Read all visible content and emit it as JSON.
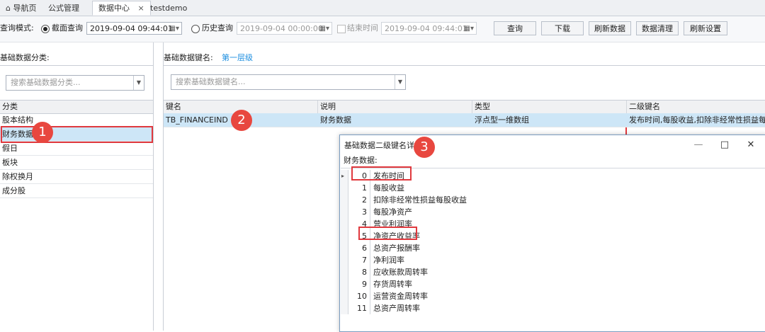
{
  "tabs": [
    {
      "label": "导航页"
    },
    {
      "label": "公式管理"
    },
    {
      "label": "数据中心",
      "close": "×"
    },
    {
      "label": "testdemo"
    }
  ],
  "toolbar": {
    "query_mode_label": "查询模式:",
    "snapshot_label": "截面查询",
    "snapshot_value": "2019-09-04 09:44:01",
    "history_label": "历史查询",
    "history_start": "2019-09-04 00:00:00",
    "end_time_label": "结束时间",
    "history_end": "2019-09-04 09:44:01",
    "buttons": [
      "查询",
      "下载",
      "刷新数据",
      "数据清理",
      "刷新设置"
    ]
  },
  "left": {
    "section_label": "基础数据分类:",
    "search_placeholder": "搜索基础数据分类...",
    "column_header": "分类",
    "items": [
      "股本结构",
      "财务数据",
      "假日",
      "板块",
      "除权换月",
      "成分股"
    ]
  },
  "right": {
    "section_label": "基础数据键名:",
    "level_label": "第一层级",
    "search_placeholder": "搜索基础数据键名...",
    "headers": [
      "键名",
      "说明",
      "类型",
      "二级键名"
    ],
    "row": {
      "key": "TB_FINANCEIND",
      "desc": "财务数据",
      "type": "浮点型一维数组",
      "sub": "发布时间,每股收益,扣除非经常性损益每股收益"
    }
  },
  "dialog": {
    "title": "基础数据二级键名详情",
    "subtitle": "财务数据:",
    "minimize": "—",
    "maximize": "□",
    "close": "✕",
    "rows": [
      {
        "idx": "0",
        "name": "发布时间"
      },
      {
        "idx": "1",
        "name": "每股收益"
      },
      {
        "idx": "2",
        "name": "扣除非经常性损益每股收益"
      },
      {
        "idx": "3",
        "name": "每股净资产"
      },
      {
        "idx": "4",
        "name": "营业利润率"
      },
      {
        "idx": "5",
        "name": "净资产收益率"
      },
      {
        "idx": "6",
        "name": "总资产报酬率"
      },
      {
        "idx": "7",
        "name": "净利润率"
      },
      {
        "idx": "8",
        "name": "应收账款周转率"
      },
      {
        "idx": "9",
        "name": "存货周转率"
      },
      {
        "idx": "10",
        "name": "运营资金周转率"
      },
      {
        "idx": "11",
        "name": "总资产周转率"
      }
    ]
  },
  "badges": [
    "1",
    "2",
    "3"
  ],
  "colors": {
    "accent": "#1e8fe0",
    "highlight": "#e0393e",
    "selection": "#cde6f7"
  }
}
